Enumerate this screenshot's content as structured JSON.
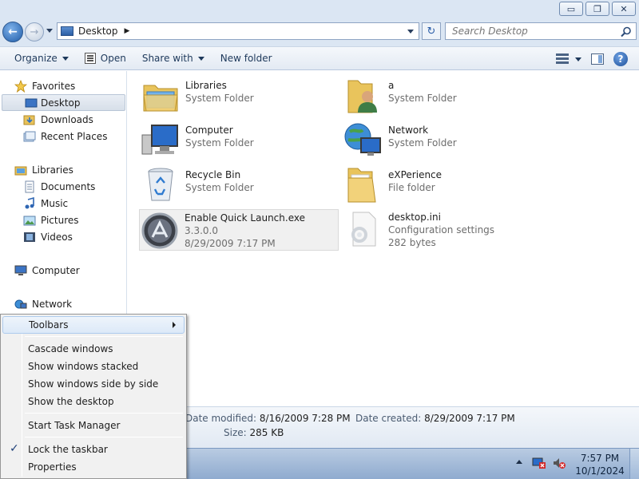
{
  "window": {
    "minimize": "▭",
    "maximize": "❐",
    "close": "✕"
  },
  "address": {
    "location": "Desktop",
    "separator": "▶",
    "search_placeholder": "Search Desktop",
    "refresh": "↻"
  },
  "toolbar": {
    "organize": "Organize",
    "open": "Open",
    "share_with": "Share with",
    "new_folder": "New folder",
    "help": "?"
  },
  "sidebar": {
    "favorites": "Favorites",
    "desktop": "Desktop",
    "downloads": "Downloads",
    "recent_places": "Recent Places",
    "libraries": "Libraries",
    "documents": "Documents",
    "music": "Music",
    "pictures": "Pictures",
    "videos": "Videos",
    "computer": "Computer",
    "network": "Network"
  },
  "items": [
    {
      "name": "Libraries",
      "sub1": "System Folder",
      "sub2": "",
      "icon": "libraries-icon"
    },
    {
      "name": "a",
      "sub1": "System Folder",
      "sub2": "",
      "icon": "user-folder-icon"
    },
    {
      "name": "Computer",
      "sub1": "System Folder",
      "sub2": "",
      "icon": "computer-icon"
    },
    {
      "name": "Network",
      "sub1": "System Folder",
      "sub2": "",
      "icon": "network-icon"
    },
    {
      "name": "Recycle Bin",
      "sub1": "System Folder",
      "sub2": "",
      "icon": "recycle-bin-icon"
    },
    {
      "name": "eXPerience",
      "sub1": "File folder",
      "sub2": "",
      "icon": "folder-icon"
    },
    {
      "name": "Enable Quick Launch.exe",
      "sub1": "3.3.0.0",
      "sub2": "8/29/2009 7:17 PM",
      "icon": "exe-icon"
    },
    {
      "name": "desktop.ini",
      "sub1": "Configuration settings",
      "sub2": "282 bytes",
      "icon": "settings-file-icon"
    }
  ],
  "details": {
    "date_modified_label": "Date modified:",
    "date_modified": "8/16/2009 7:28 PM",
    "date_created_label": "Date created:",
    "date_created": "8/29/2009 7:17 PM",
    "size_label": "Size:",
    "size": "285 KB"
  },
  "context_menu": {
    "toolbars": "Toolbars",
    "cascade": "Cascade windows",
    "stacked": "Show windows stacked",
    "side_by_side": "Show windows side by side",
    "show_desktop": "Show the desktop",
    "task_manager": "Start Task Manager",
    "lock_taskbar": "Lock the taskbar",
    "lock_checked_glyph": "✓",
    "properties": "Properties"
  },
  "taskbar": {
    "time": "7:57 PM",
    "date": "10/1/2024"
  }
}
